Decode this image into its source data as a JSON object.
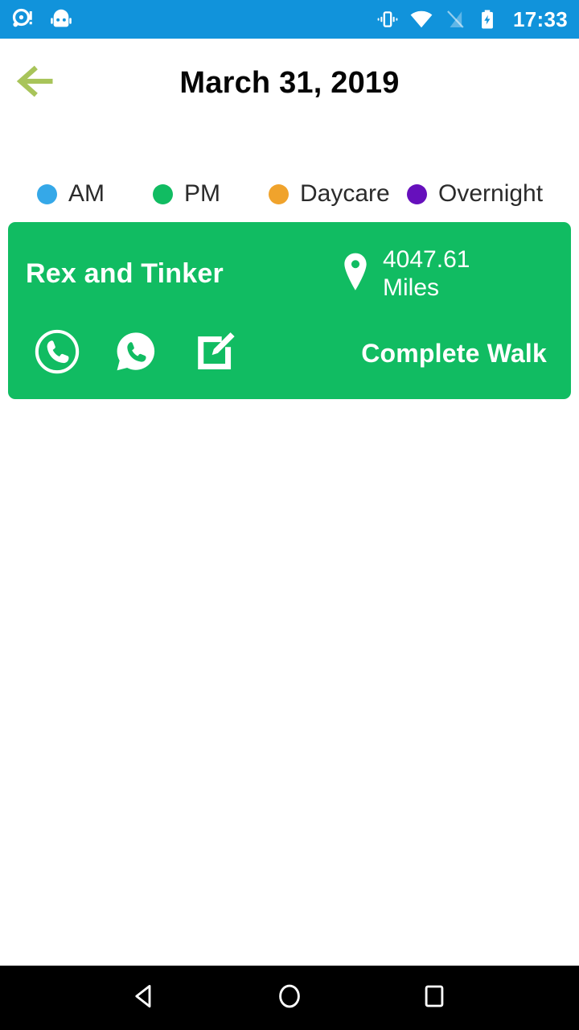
{
  "status_bar": {
    "background_color": "#1193db",
    "clock": "17:33",
    "left_icons": [
      {
        "name": "notification-alert-icon"
      },
      {
        "name": "cyanogenmod-robot-icon"
      }
    ],
    "right_icons": [
      {
        "name": "vibrate-icon"
      },
      {
        "name": "wifi-icon"
      },
      {
        "name": "no-sim-signal-icon"
      },
      {
        "name": "battery-charging-icon"
      }
    ]
  },
  "app_bar": {
    "back_icon": "arrow-left-icon",
    "back_icon_color": "#a8c45a",
    "title": "March 31, 2019"
  },
  "legend": {
    "items": [
      {
        "label": "AM",
        "color": "#35a8e8"
      },
      {
        "label": "PM",
        "color": "#11bc62"
      },
      {
        "label": "Daycare",
        "color": "#f0a32c"
      },
      {
        "label": "Overnight",
        "color": "#6610bc"
      }
    ]
  },
  "walk_card": {
    "background_color": "#11bc62",
    "pet_name": "Rex and Tinker",
    "distance_value": "4047.61",
    "distance_unit": "Miles",
    "pin_icon": "map-pin-icon",
    "actions": [
      {
        "name": "call-icon"
      },
      {
        "name": "whatsapp-icon"
      },
      {
        "name": "edit-note-icon"
      }
    ],
    "complete_label": "Complete Walk"
  },
  "nav_bar": {
    "background_color": "#000000",
    "buttons": [
      {
        "name": "nav-back-icon"
      },
      {
        "name": "nav-home-icon"
      },
      {
        "name": "nav-recents-icon"
      }
    ]
  }
}
